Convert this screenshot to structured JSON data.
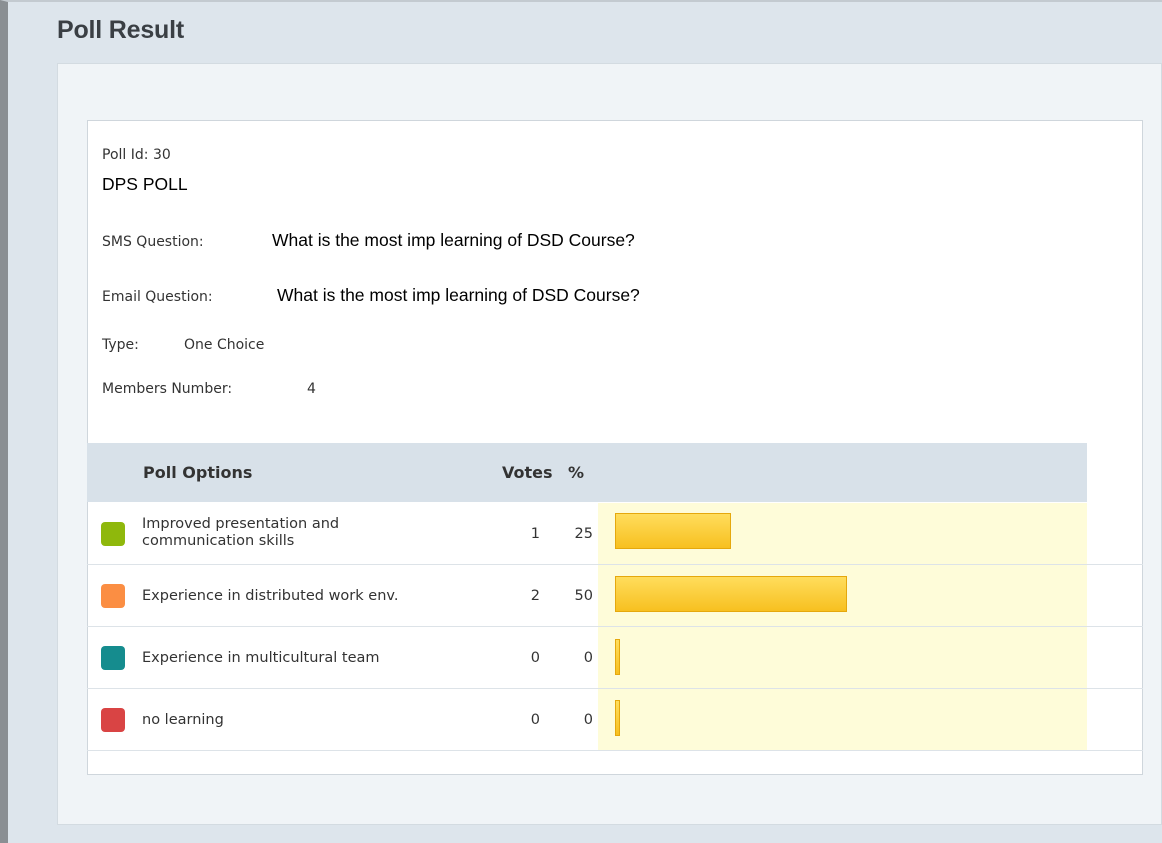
{
  "page": {
    "title": "Poll Result"
  },
  "poll": {
    "id_label": "Poll Id:",
    "id_value": "30",
    "name": "DPS POLL",
    "sms_label": "SMS Question:",
    "sms_question": "What is the most imp learning of DSD Course?",
    "email_label": "Email Question:",
    "email_question": "What is the most imp learning of DSD Course?",
    "type_label": "Type:",
    "type_value": "One Choice",
    "members_label": "Members Number:",
    "members_value": "4"
  },
  "table": {
    "col_options": "Poll Options",
    "col_votes": "Votes",
    "col_percent": "%",
    "rows": [
      {
        "label_line1": "Improved presentation and",
        "label_line2": "communication skills",
        "votes": "1",
        "percent": "25",
        "color": "#8fb80c"
      },
      {
        "label_line1": "Experience in distributed work env.",
        "label_line2": "",
        "votes": "2",
        "percent": "50",
        "color": "#fb8e43"
      },
      {
        "label_line1": "Experience in multicultural team",
        "label_line2": "",
        "votes": "0",
        "percent": "0",
        "color": "#158c8e"
      },
      {
        "label_line1": "no learning",
        "label_line2": "",
        "votes": "0",
        "percent": "0",
        "color": "#d94444"
      }
    ]
  }
}
